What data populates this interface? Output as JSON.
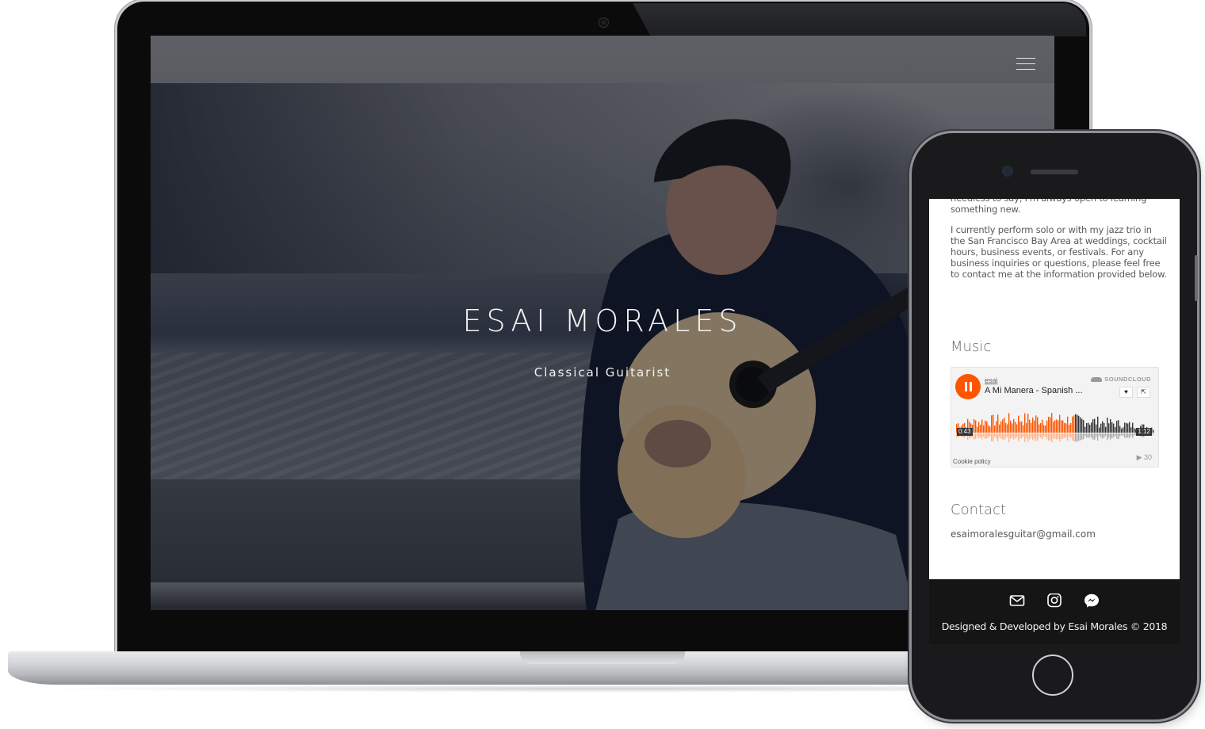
{
  "desktop": {
    "hero": {
      "title": "ESAI MORALES",
      "subtitle": "Classical Guitarist"
    },
    "nav": {
      "menu_icon": "hamburger-menu-icon"
    }
  },
  "mobile": {
    "about": {
      "cut_line": "needless to say, I'm always open to learning something new.",
      "paragraph": "I currently perform solo or with my jazz trio in the San Francisco Bay Area at weddings, cocktail hours, business events, or festivals. For any business inquiries or questions, please feel free to contact me at the information provided below."
    },
    "music": {
      "heading": "Music",
      "player": {
        "user": "esai",
        "track_title": "A Mi Manera - Spanish ...",
        "brand": "SOUNDCLOUD",
        "elapsed": "0:43",
        "duration": "1:12",
        "played_fraction": 0.6,
        "plays": "▶ 30",
        "cookie_link": "Cookie policy",
        "accent_color": "#ff5500"
      }
    },
    "contact": {
      "heading": "Contact",
      "email": "esaimoralesguitar@gmail.com"
    },
    "footer": {
      "icons": [
        "envelope-icon",
        "instagram-icon",
        "messenger-icon"
      ],
      "credit": "Designed & Developed by Esai Morales © 2018"
    }
  }
}
